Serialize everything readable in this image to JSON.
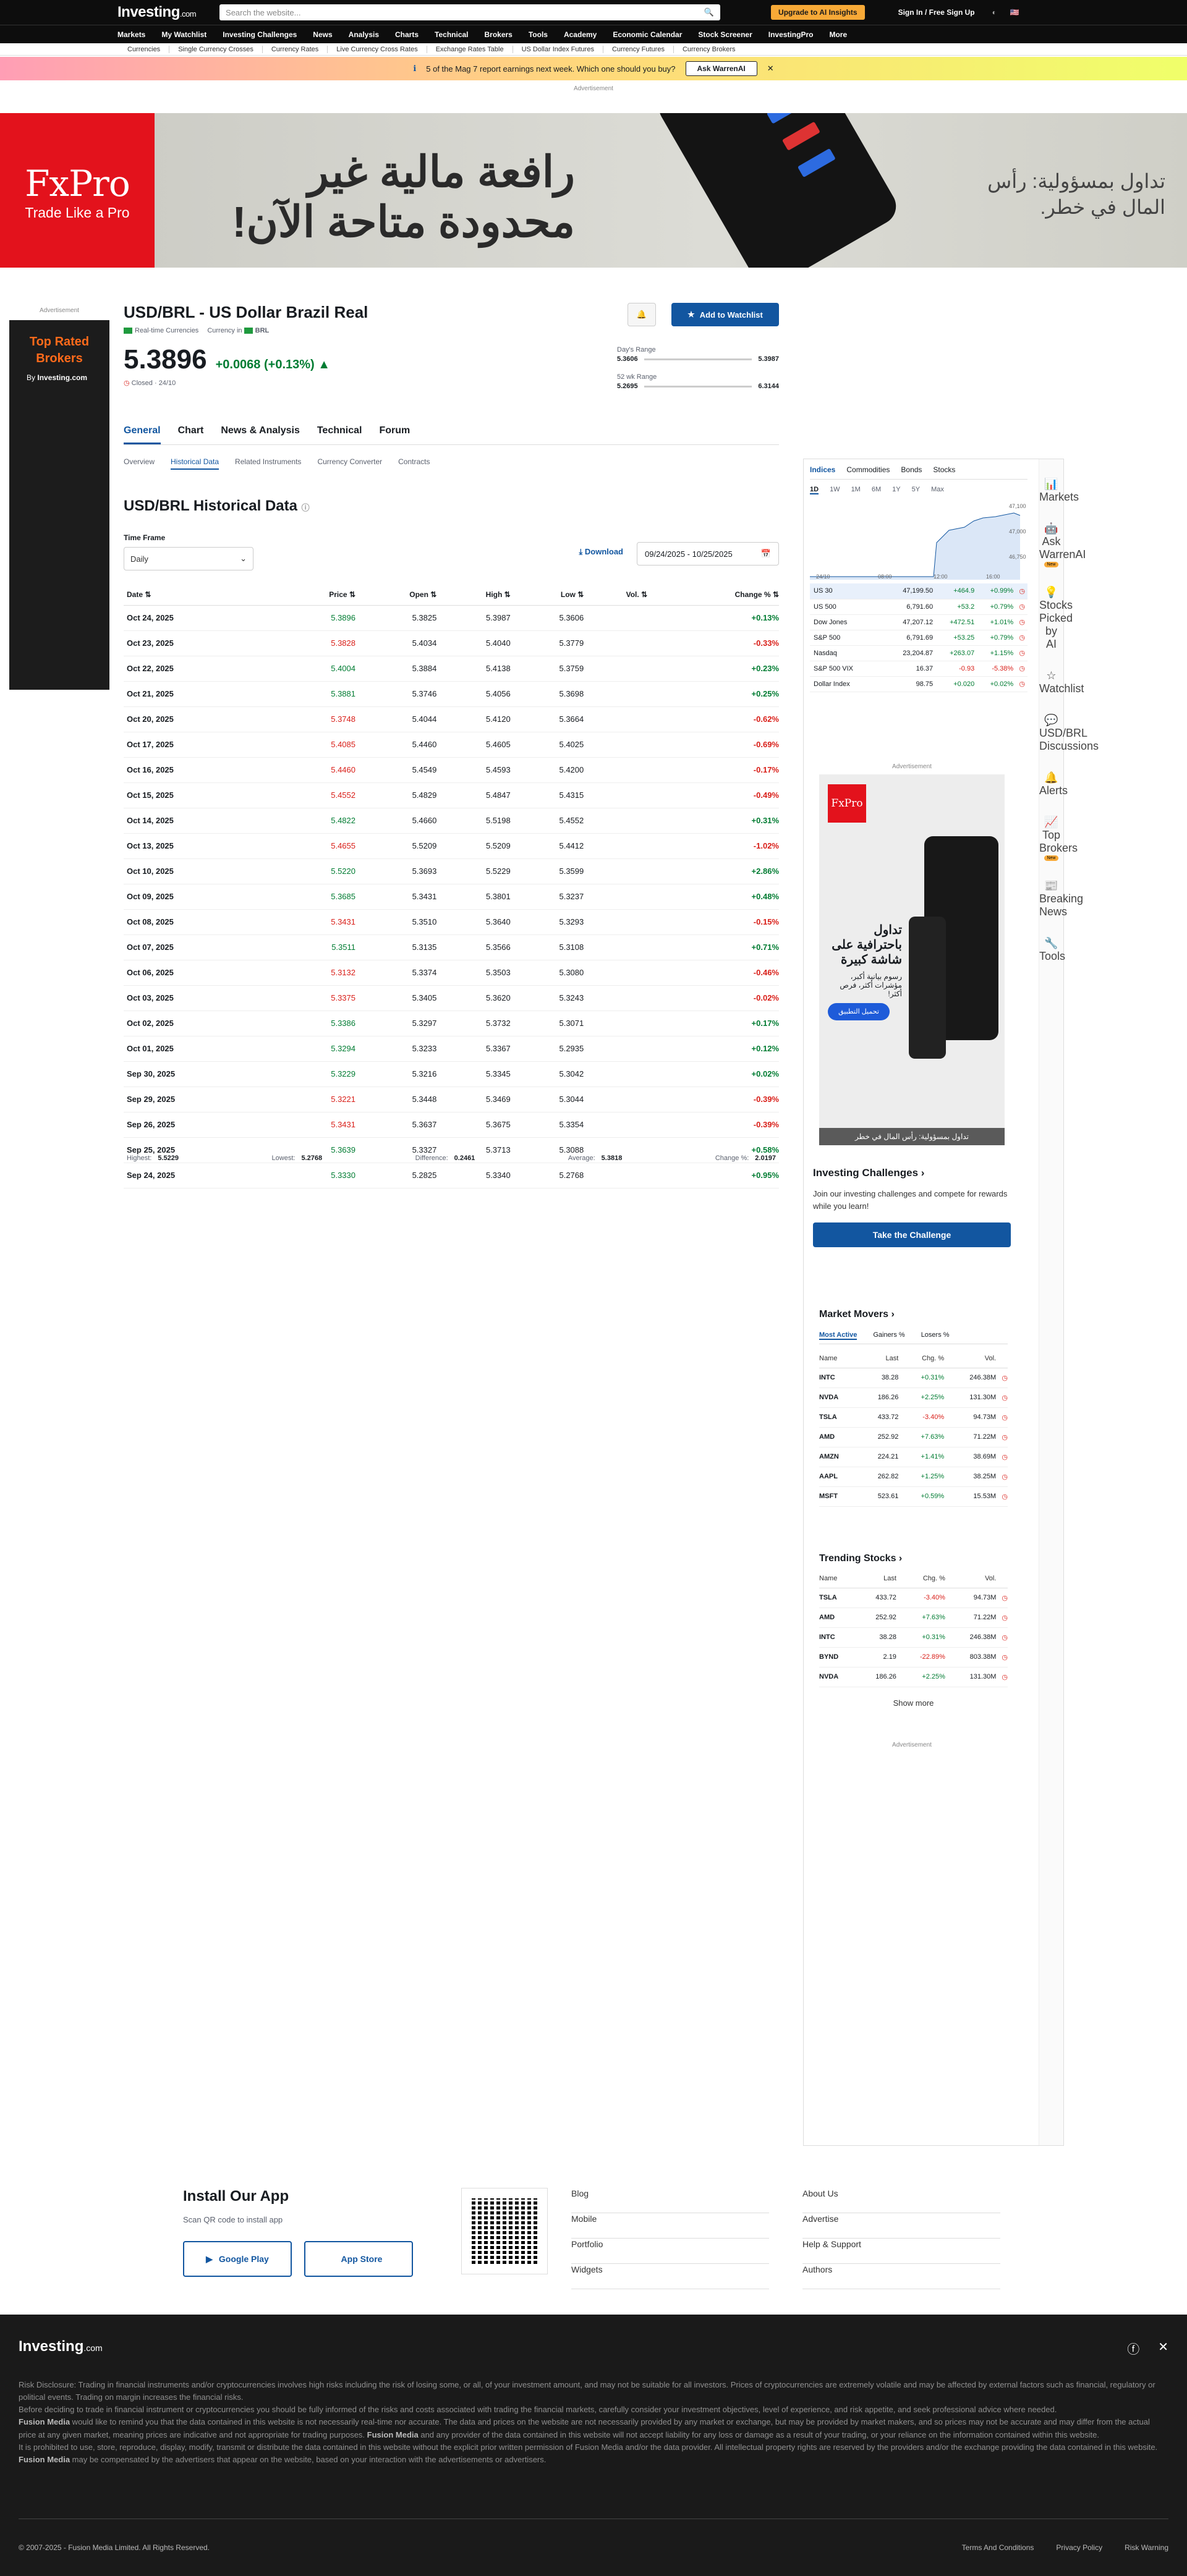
{
  "header": {
    "logo": "Investing",
    "logo_suffix": ".com",
    "search_placeholder": "Search the website...",
    "upgrade": "Upgrade to AI Insights",
    "sign_in": "Sign In",
    "sep": "/",
    "sign_up": "Free Sign Up",
    "nav": [
      "Markets",
      "My Watchlist",
      "Investing Challenges",
      "News",
      "Analysis",
      "Charts",
      "Technical",
      "Brokers",
      "Tools",
      "Academy",
      "Economic Calendar",
      "Stock Screener",
      "InvestingPro",
      "More"
    ],
    "subnav": [
      "Currencies",
      "Single Currency Crosses",
      "Currency Rates",
      "Live Currency Cross Rates",
      "Exchange Rates Table",
      "US Dollar Index Futures",
      "Currency Futures",
      "Currency Brokers"
    ]
  },
  "promo": {
    "text": "5 of the Mag 7 report earnings next week. Which one should you buy?",
    "button": "Ask WarrenAI",
    "close": "✕"
  },
  "ad_label": "Advertisement",
  "banner": {
    "brand": "FxPro",
    "tagline": "Trade Like a Pro",
    "headline": "رافعة مالية غير محدودة متاحة الآن!",
    "right_text": "تداول بمسؤولية: رأس المال في خطر."
  },
  "left_ad": {
    "headline": "Top Rated Brokers",
    "by": "By",
    "brand": "Investing.com"
  },
  "instrument": {
    "title": "USD/BRL - US Dollar Brazil Real",
    "realtime": "Real-time Currencies",
    "currency_in": "Currency in",
    "currency": "BRL",
    "price": "5.3896",
    "change": "+0.0068 (+0.13%)",
    "status": "Closed · 24/10",
    "watchlist_button": "Add to Watchlist",
    "day_range_label": "Day's Range",
    "day_low": "5.3606",
    "day_high": "5.3987",
    "wk52_label": "52 wk Range",
    "wk52_low": "5.2695",
    "wk52_high": "6.3144"
  },
  "tabs": [
    "General",
    "Chart",
    "News & Analysis",
    "Technical",
    "Forum"
  ],
  "subtabs": [
    "Overview",
    "Historical Data",
    "Related Instruments",
    "Currency Converter",
    "Contracts"
  ],
  "historical": {
    "title": "USD/BRL Historical Data",
    "timeframe_label": "Time Frame",
    "timeframe": "Daily",
    "download": "Download",
    "date_range": "09/24/2025 - 10/25/2025",
    "columns": [
      "Date",
      "Price",
      "Open",
      "High",
      "Low",
      "Vol.",
      "Change %"
    ],
    "rows": [
      [
        "Oct 24, 2025",
        "5.3896",
        "5.3825",
        "5.3987",
        "5.3606",
        "",
        "+0.13%",
        "up"
      ],
      [
        "Oct 23, 2025",
        "5.3828",
        "5.4034",
        "5.4040",
        "5.3779",
        "",
        "-0.33%",
        "dn"
      ],
      [
        "Oct 22, 2025",
        "5.4004",
        "5.3884",
        "5.4138",
        "5.3759",
        "",
        "+0.23%",
        "up"
      ],
      [
        "Oct 21, 2025",
        "5.3881",
        "5.3746",
        "5.4056",
        "5.3698",
        "",
        "+0.25%",
        "up"
      ],
      [
        "Oct 20, 2025",
        "5.3748",
        "5.4044",
        "5.4120",
        "5.3664",
        "",
        "-0.62%",
        "dn"
      ],
      [
        "Oct 17, 2025",
        "5.4085",
        "5.4460",
        "5.4605",
        "5.4025",
        "",
        "-0.69%",
        "dn"
      ],
      [
        "Oct 16, 2025",
        "5.4460",
        "5.4549",
        "5.4593",
        "5.4200",
        "",
        "-0.17%",
        "dn"
      ],
      [
        "Oct 15, 2025",
        "5.4552",
        "5.4829",
        "5.4847",
        "5.4315",
        "",
        "-0.49%",
        "dn"
      ],
      [
        "Oct 14, 2025",
        "5.4822",
        "5.4660",
        "5.5198",
        "5.4552",
        "",
        "+0.31%",
        "up"
      ],
      [
        "Oct 13, 2025",
        "5.4655",
        "5.5209",
        "5.5209",
        "5.4412",
        "",
        "-1.02%",
        "dn"
      ],
      [
        "Oct 10, 2025",
        "5.5220",
        "5.3693",
        "5.5229",
        "5.3599",
        "",
        "+2.86%",
        "up"
      ],
      [
        "Oct 09, 2025",
        "5.3685",
        "5.3431",
        "5.3801",
        "5.3237",
        "",
        "+0.48%",
        "up"
      ],
      [
        "Oct 08, 2025",
        "5.3431",
        "5.3510",
        "5.3640",
        "5.3293",
        "",
        "-0.15%",
        "dn"
      ],
      [
        "Oct 07, 2025",
        "5.3511",
        "5.3135",
        "5.3566",
        "5.3108",
        "",
        "+0.71%",
        "up"
      ],
      [
        "Oct 06, 2025",
        "5.3132",
        "5.3374",
        "5.3503",
        "5.3080",
        "",
        "-0.46%",
        "dn"
      ],
      [
        "Oct 03, 2025",
        "5.3375",
        "5.3405",
        "5.3620",
        "5.3243",
        "",
        "-0.02%",
        "dn"
      ],
      [
        "Oct 02, 2025",
        "5.3386",
        "5.3297",
        "5.3732",
        "5.3071",
        "",
        "+0.17%",
        "up"
      ],
      [
        "Oct 01, 2025",
        "5.3294",
        "5.3233",
        "5.3367",
        "5.2935",
        "",
        "+0.12%",
        "up"
      ],
      [
        "Sep 30, 2025",
        "5.3229",
        "5.3216",
        "5.3345",
        "5.3042",
        "",
        "+0.02%",
        "up"
      ],
      [
        "Sep 29, 2025",
        "5.3221",
        "5.3448",
        "5.3469",
        "5.3044",
        "",
        "-0.39%",
        "dn"
      ],
      [
        "Sep 26, 2025",
        "5.3431",
        "5.3637",
        "5.3675",
        "5.3354",
        "",
        "-0.39%",
        "dn"
      ],
      [
        "Sep 25, 2025",
        "5.3639",
        "5.3327",
        "5.3713",
        "5.3088",
        "",
        "+0.58%",
        "up"
      ],
      [
        "Sep 24, 2025",
        "5.3330",
        "5.2825",
        "5.3340",
        "5.2768",
        "",
        "+0.95%",
        "up"
      ]
    ],
    "summary": {
      "highest_label": "Highest:",
      "highest": "5.5229",
      "lowest_label": "Lowest:",
      "lowest": "5.2768",
      "diff_label": "Difference:",
      "diff": "0.2461",
      "avg_label": "Average:",
      "avg": "5.3818",
      "chg_label": "Change %:",
      "chg": "2.0197"
    }
  },
  "watchlist": {
    "tabs": [
      "Indices",
      "Commodities",
      "Bonds",
      "Stocks"
    ],
    "periods": [
      "1D",
      "1W",
      "1M",
      "6M",
      "1Y",
      "5Y",
      "Max"
    ],
    "mini_chart": {
      "y_labels": [
        "47,100",
        "47,000",
        "46,750"
      ],
      "x_labels": [
        "24/10",
        "08:00",
        "12:00",
        "16:00"
      ]
    },
    "rows": [
      [
        "US 30",
        "47,199.50",
        "+464.9",
        "+0.99%",
        "up"
      ],
      [
        "US 500",
        "6,791.60",
        "+53.2",
        "+0.79%",
        "up"
      ],
      [
        "Dow Jones",
        "47,207.12",
        "+472.51",
        "+1.01%",
        "up"
      ],
      [
        "S&P 500",
        "6,791.69",
        "+53.25",
        "+0.79%",
        "up"
      ],
      [
        "Nasdaq",
        "23,204.87",
        "+263.07",
        "+1.15%",
        "up"
      ],
      [
        "S&P 500 VIX",
        "16.37",
        "-0.93",
        "-5.38%",
        "dn"
      ],
      [
        "Dollar Index",
        "98.75",
        "+0.020",
        "+0.02%",
        "up"
      ]
    ]
  },
  "rail": [
    {
      "icon": "📊",
      "label": "Markets"
    },
    {
      "icon": "🤖",
      "label": "Ask WarrenAI"
    },
    {
      "icon": "💡",
      "label": "Stocks Picked by AI"
    },
    {
      "icon": "☆",
      "label": "Watchlist"
    },
    {
      "icon": "💬",
      "label": "USD/BRL Discussions"
    },
    {
      "icon": "🔔",
      "label": "Alerts"
    },
    {
      "icon": "📈",
      "label": "Top Brokers"
    },
    {
      "icon": "📰",
      "label": "Breaking News"
    },
    {
      "icon": "🔧",
      "label": "Tools"
    }
  ],
  "rail_badge": "New",
  "side_ad": {
    "brand": "FxPro",
    "headline": "تداول باحترافية على شاشة كبيرة",
    "sub": "رسوم بيانية أكبر، مؤشرات أكثر، فرص أكثر!",
    "button": "تحميل التطبيق",
    "footer": "تداول بمسؤولية: رأس المال في خطر"
  },
  "challenges": {
    "title": "Investing Challenges",
    "text": "Join our investing challenges and compete for rewards while you learn!",
    "button": "Take the Challenge"
  },
  "market_movers": {
    "title": "Market Movers",
    "tabs": [
      "Most Active",
      "Gainers %",
      "Losers %"
    ],
    "columns": [
      "Name",
      "Last",
      "Chg. %",
      "Vol."
    ],
    "rows": [
      [
        "INTC",
        "38.28",
        "+0.31%",
        "246.38M",
        "up"
      ],
      [
        "NVDA",
        "186.26",
        "+2.25%",
        "131.30M",
        "up"
      ],
      [
        "TSLA",
        "433.72",
        "-3.40%",
        "94.73M",
        "dn"
      ],
      [
        "AMD",
        "252.92",
        "+7.63%",
        "71.22M",
        "up"
      ],
      [
        "AMZN",
        "224.21",
        "+1.41%",
        "38.69M",
        "up"
      ],
      [
        "AAPL",
        "262.82",
        "+1.25%",
        "38.25M",
        "up"
      ],
      [
        "MSFT",
        "523.61",
        "+0.59%",
        "15.53M",
        "up"
      ]
    ]
  },
  "trending": {
    "title": "Trending Stocks",
    "columns": [
      "Name",
      "Last",
      "Chg. %",
      "Vol."
    ],
    "rows": [
      [
        "TSLA",
        "433.72",
        "-3.40%",
        "94.73M",
        "dn"
      ],
      [
        "AMD",
        "252.92",
        "+7.63%",
        "71.22M",
        "up"
      ],
      [
        "INTC",
        "38.28",
        "+0.31%",
        "246.38M",
        "up"
      ],
      [
        "BYND",
        "2.19",
        "-22.89%",
        "803.38M",
        "dn"
      ],
      [
        "NVDA",
        "186.26",
        "+2.25%",
        "131.30M",
        "up"
      ]
    ],
    "show_more": "Show more"
  },
  "app": {
    "title": "Install Our App",
    "text": "Scan QR code to install app",
    "google": "Google Play",
    "apple": "App Store",
    "links1": [
      "Blog",
      "Mobile",
      "Portfolio",
      "Widgets"
    ],
    "links2": [
      "About Us",
      "Advertise",
      "Help & Support",
      "Authors"
    ]
  },
  "footer": {
    "logo": "Investing",
    "logo_suffix": ".com",
    "p1": "Risk Disclosure: Trading in financial instruments and/or cryptocurrencies involves high risks including the risk of losing some, or all, of your investment amount, and may not be suitable for all investors. Prices of cryptocurrencies are extremely volatile and may be affected by external factors such as financial, regulatory or political events. Trading on margin increases the financial risks.",
    "p2": "Before deciding to trade in financial instrument or cryptocurrencies you should be fully informed of the risks and costs associated with trading the financial markets, carefully consider your investment objectives, level of experience, and risk appetite, and seek professional advice where needed.",
    "fm": "Fusion Media",
    "p3": " would like to remind you that the data contained in this website is not necessarily real-time nor accurate. The data and prices on the website are not necessarily provided by any market or exchange, but may be provided by market makers, and so prices may not be accurate and may differ from the actual price at any given market, meaning prices are indicative and not appropriate for trading purposes.",
    "p4": " and any provider of the data contained in this website will not accept liability for any loss or damage as a result of your trading, or your reliance on the information contained within this website.",
    "p5": "It is prohibited to use, store, reproduce, display, modify, transmit or distribute the data contained in this website without the explicit prior written permission of Fusion Media and/or the data provider. All intellectual property rights are reserved by the providers and/or the exchange providing the data contained in this website.",
    "p6": " may be compensated by the advertisers that appear on the website, based on your interaction with the advertisements or advertisers.",
    "copy": "© 2007-2025 - Fusion Media Limited. All Rights Reserved.",
    "legal": [
      "Terms And Conditions",
      "Privacy Policy",
      "Risk Warning"
    ]
  }
}
